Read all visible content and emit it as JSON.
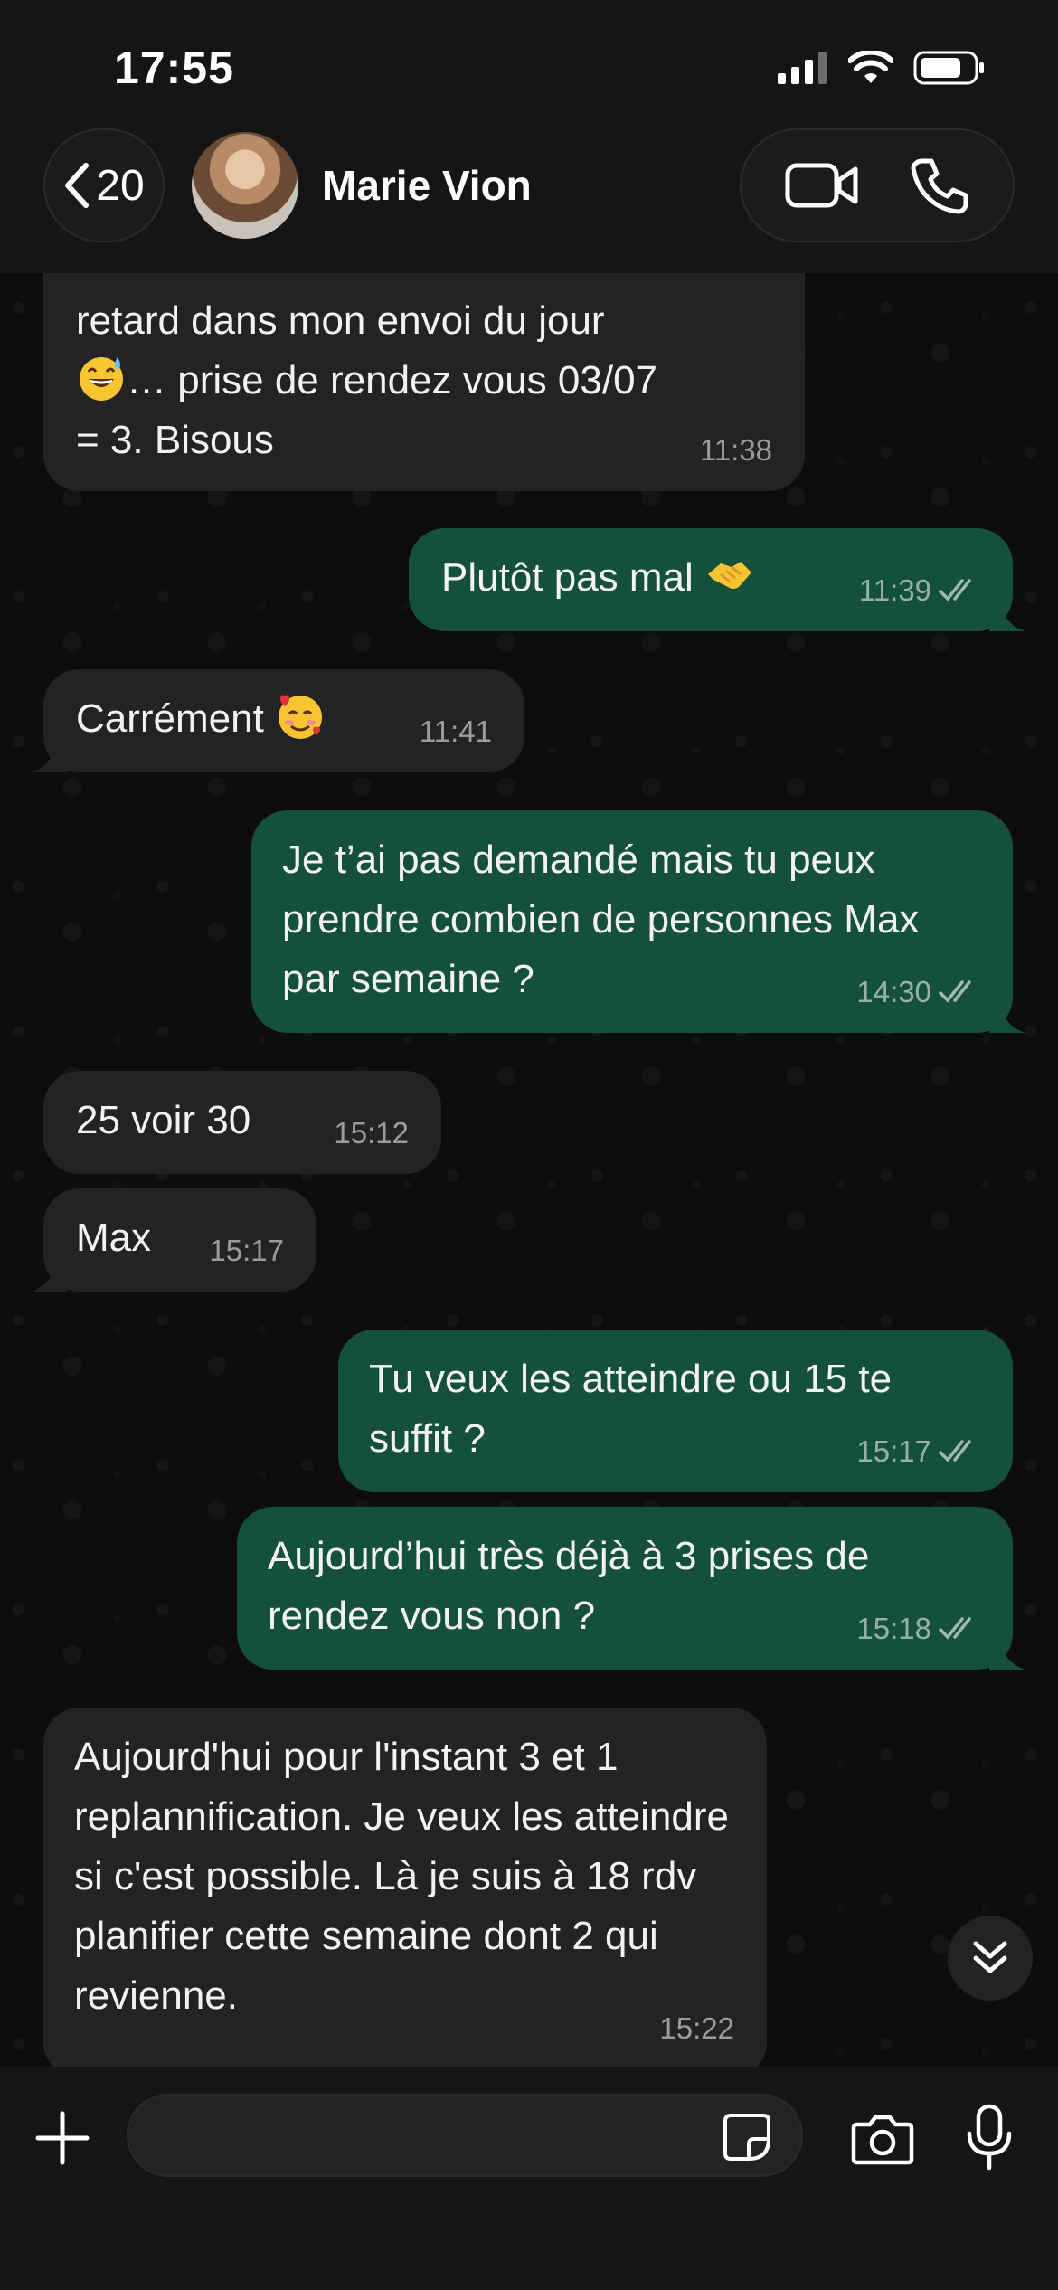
{
  "status_bar": {
    "time": "17:55"
  },
  "header": {
    "back_count": "20",
    "contact_name": "Marie Vion"
  },
  "messages": [
    {
      "direction": "in",
      "text_lines": [
        "retard dans mon envoi du jour",
        "…  prise de rendez vous 03/07",
        "= 3. Bisous"
      ],
      "emoji": "sweat-smile",
      "time": "11:38"
    },
    {
      "direction": "out",
      "text": "Plutôt pas mal",
      "emoji": "handshake",
      "time": "11:39",
      "read": true
    },
    {
      "direction": "in",
      "text": "Carrément",
      "emoji": "smiling-hearts",
      "time": "11:41"
    },
    {
      "direction": "out",
      "text": "Je t’ai pas demandé mais tu peux prendre combien de personnes Max par semaine ?",
      "time": "14:30",
      "read": true
    },
    {
      "direction": "in",
      "text": "25 voir 30",
      "time": "15:12"
    },
    {
      "direction": "in",
      "text": "Max",
      "time": "15:17"
    },
    {
      "direction": "out",
      "text": "Tu veux les atteindre ou 15 te suffit ?",
      "time": "15:17",
      "read": true
    },
    {
      "direction": "out",
      "text": "Aujourd’hui très déjà à 3 prises de rendez vous non ?",
      "time": "15:18",
      "read": true
    },
    {
      "direction": "in",
      "text": "Aujourd'hui pour l'instant 3 et 1 replannification. Je veux les atteindre si c'est possible. Là je suis à 18 rdv planifier cette semaine dont 2 qui revienne.",
      "time": "15:22"
    }
  ],
  "composer": {
    "placeholder": ""
  },
  "colors": {
    "incoming": "#232325",
    "outgoing": "#15503b",
    "background": "#0d0d0d"
  },
  "icons": [
    "chevron-left-icon",
    "video-icon",
    "phone-icon",
    "double-chevron-down-icon",
    "plus-icon",
    "sticker-icon",
    "camera-icon",
    "mic-icon",
    "double-check-icon"
  ]
}
